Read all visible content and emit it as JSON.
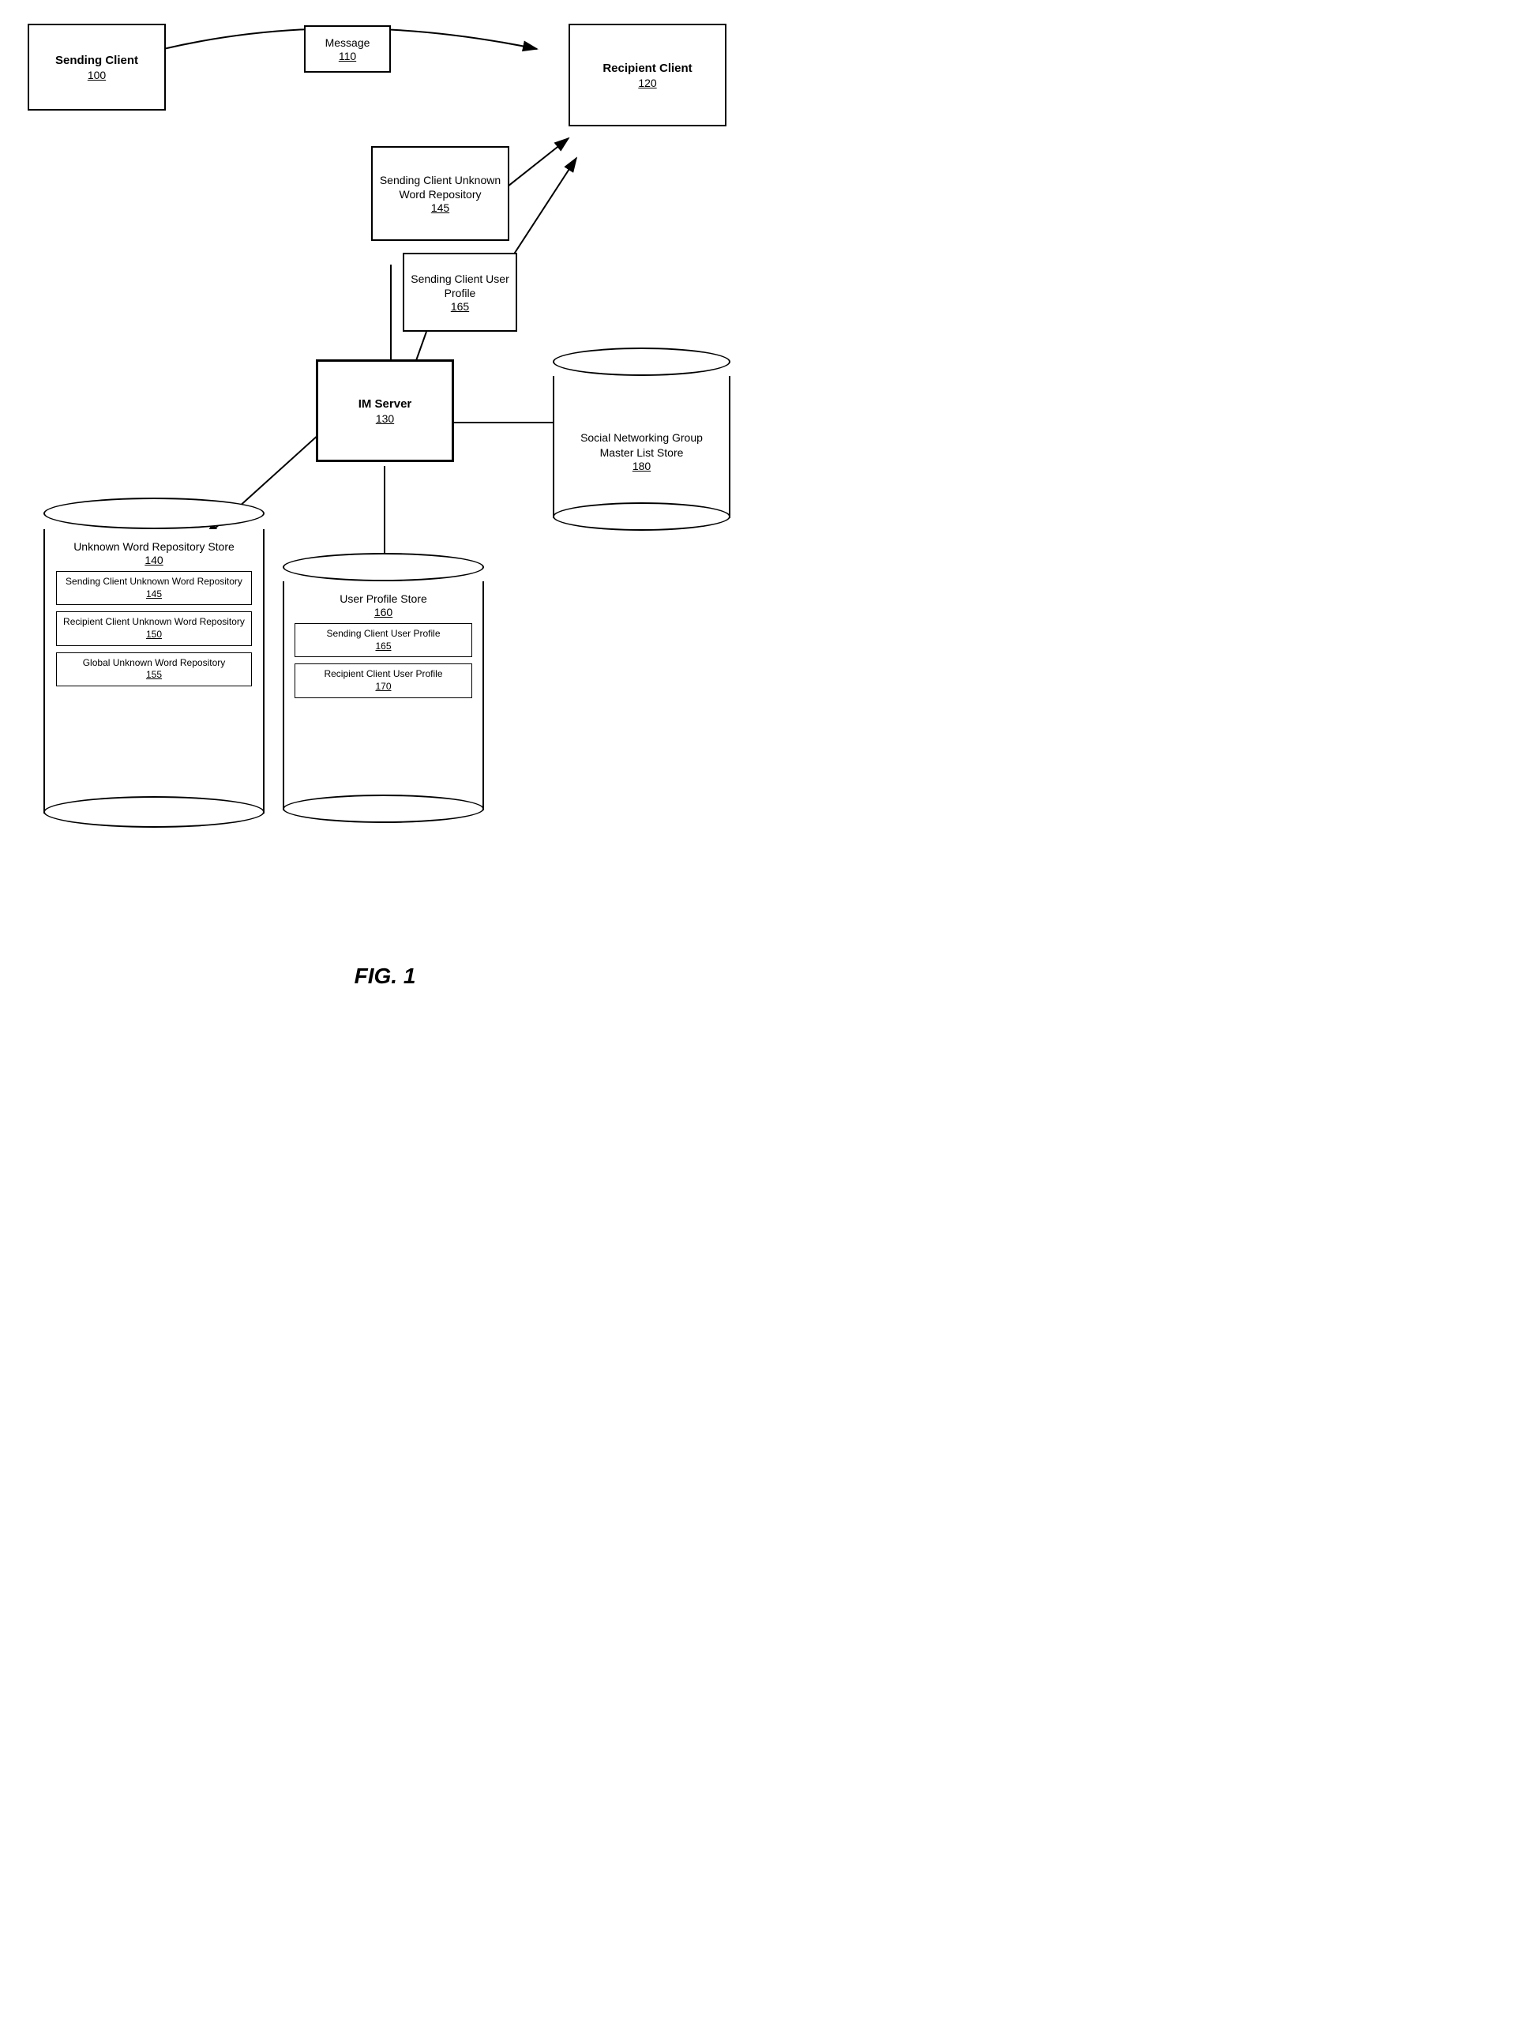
{
  "nodes": {
    "sending_client": {
      "title": "Sending Client",
      "id": "100"
    },
    "message": {
      "title": "Message",
      "id": "110"
    },
    "recipient_client": {
      "title": "Recipient Client",
      "id": "120"
    },
    "sending_client_unknown_word_repo_top": {
      "title": "Sending Client Unknown Word Repository",
      "id": "145"
    },
    "sending_client_user_profile_top": {
      "title": "Sending Client User Profile",
      "id": "165"
    },
    "im_server": {
      "title": "IM Server",
      "id": "130"
    },
    "unknown_word_repo_store": {
      "title": "Unknown Word Repository Store",
      "id": "140"
    },
    "inner_sending_client_unknown": {
      "title": "Sending Client Unknown Word Repository",
      "id": "145"
    },
    "inner_recipient_client_unknown": {
      "title": "Recipient Client Unknown Word Repository",
      "id": "150"
    },
    "inner_global_unknown": {
      "title": "Global Unknown Word Repository",
      "id": "155"
    },
    "user_profile_store": {
      "title": "User Profile Store",
      "id": "160"
    },
    "inner_sending_user_profile": {
      "title": "Sending Client User Profile",
      "id": "165"
    },
    "inner_recipient_user_profile": {
      "title": "Recipient Client User Profile",
      "id": "170"
    },
    "social_networking": {
      "title": "Social Networking Group Master List Store",
      "id": "180"
    }
  },
  "figure": {
    "caption": "FIG. 1"
  }
}
